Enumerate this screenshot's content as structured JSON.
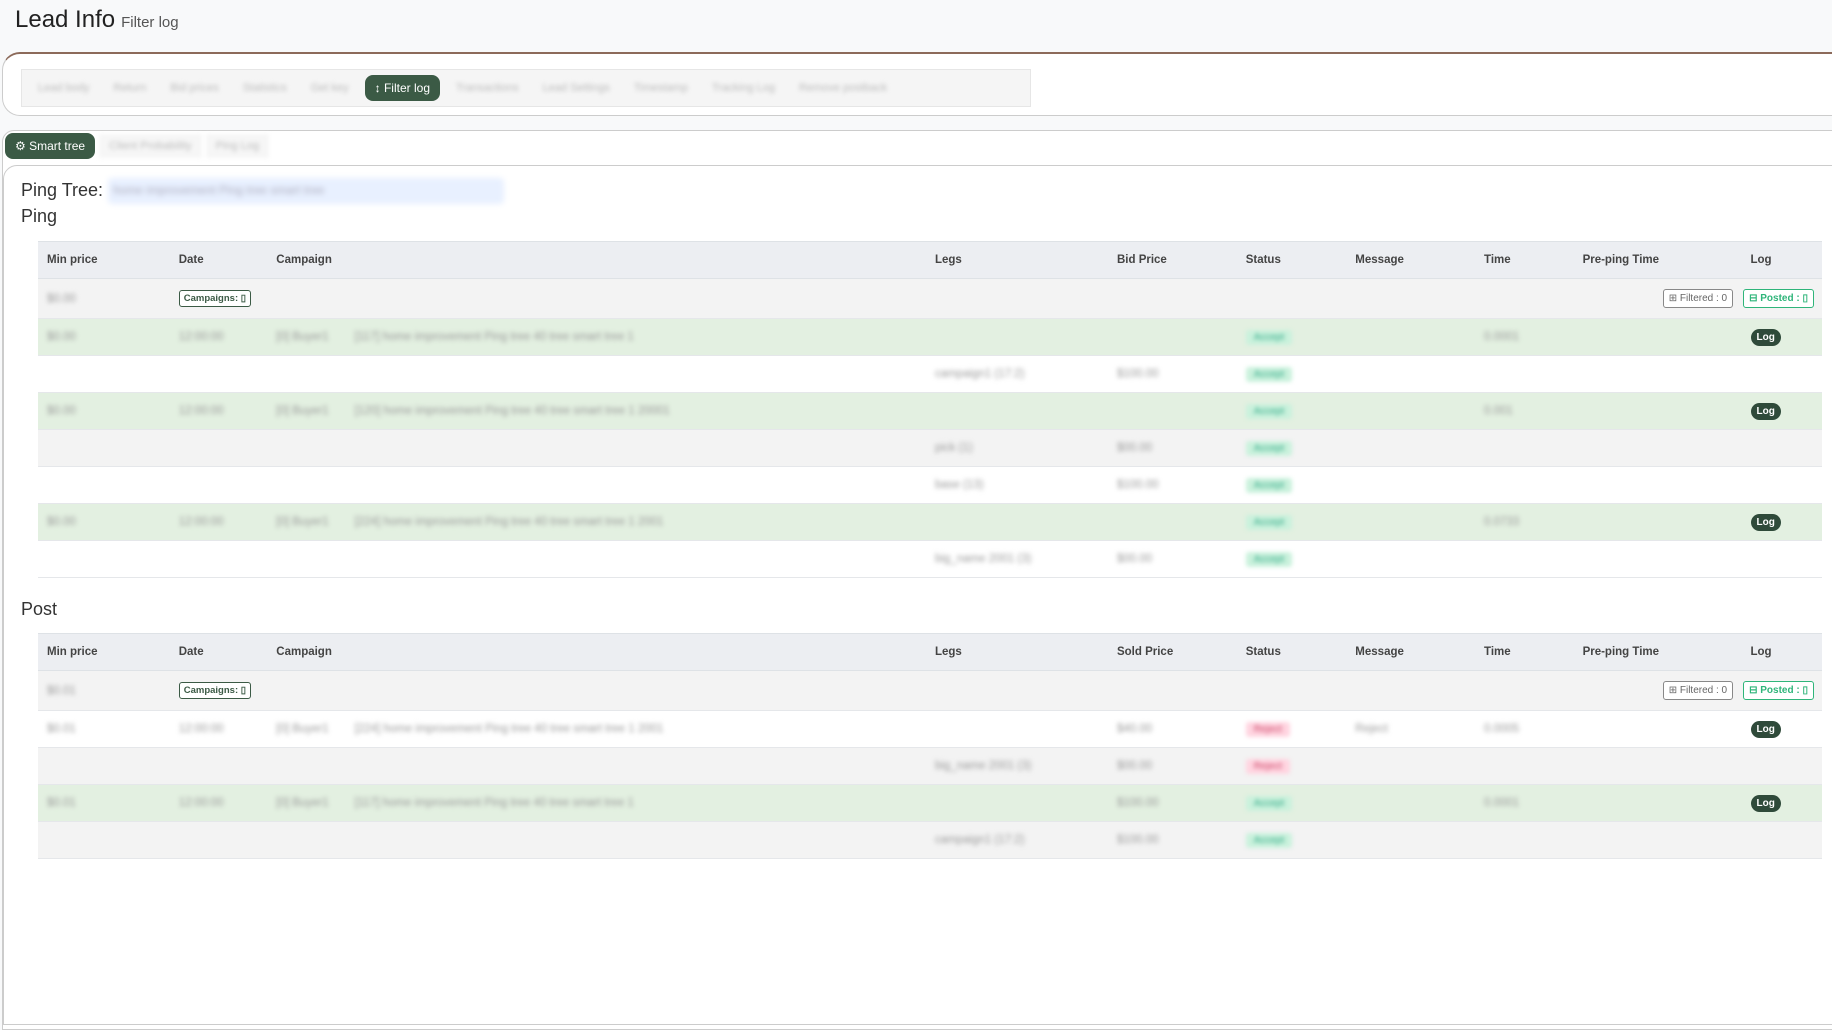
{
  "header": {
    "title": "Lead Info",
    "subtitle": "Filter log"
  },
  "tabs": [
    "Lead body",
    "Return",
    "Bid prices",
    "Statistics",
    "Get key",
    "Filter log",
    "Transactions",
    "Lead Settings",
    "Timestamp",
    "Tracking Log",
    "Remove postback"
  ],
  "subtabs": [
    "Smart tree",
    "Client Probability",
    "Ping Log"
  ],
  "ping_tree_label": "Ping Tree:",
  "ping_tree_value": "home improvement Ping tree smart tree",
  "ping": {
    "title": "Ping",
    "headers": [
      "Min price",
      "Date",
      "Campaign",
      "Legs",
      "Bid Price",
      "Status",
      "Message",
      "Time",
      "Pre-ping Time",
      "Log"
    ],
    "summary": {
      "min": "$0.00",
      "campaigns": "Campaigns:",
      "filtered": "Filtered : 0",
      "posted": "Posted :"
    },
    "rows": [
      {
        "type": "g",
        "min": "$0.00",
        "date": "12:00:00",
        "id": "[0] Buyer1",
        "camp": "[117] home improvement Ping tree 40 tree smart tree 1",
        "legs": "",
        "price": "",
        "status": "Accept",
        "time": "0.0001",
        "log": "Log"
      },
      {
        "type": "w",
        "legs": "campaign1 (17:2)",
        "price": "$100.00",
        "status": "Accept"
      },
      {
        "type": "g",
        "min": "$0.00",
        "date": "12:00:00",
        "id": "[0] Buyer1",
        "camp": "[120] home improvement Ping tree 40 tree smart tree 1 20001",
        "legs": "",
        "price": "",
        "status": "Accept",
        "time": "0.001",
        "log": "Log"
      },
      {
        "type": "gr",
        "legs": "pick (1)",
        "price": "$00.00",
        "status": "Accept"
      },
      {
        "type": "w",
        "legs": "base (13)",
        "price": "$100.00",
        "status": "Accept"
      },
      {
        "type": "g",
        "min": "$0.00",
        "date": "12:00:00",
        "id": "[0] Buyer1",
        "camp": "[224] home improvement Ping tree 40 tree smart tree 1 2001",
        "legs": "",
        "price": "",
        "status": "Accept",
        "time": "0.0733",
        "log": "Log"
      },
      {
        "type": "w",
        "legs": "big_name 2001 (3)",
        "price": "$00.00",
        "status": "Accept"
      }
    ]
  },
  "post": {
    "title": "Post",
    "headers": [
      "Min price",
      "Date",
      "Campaign",
      "Legs",
      "Sold Price",
      "Status",
      "Message",
      "Time",
      "Pre-ping Time",
      "Log"
    ],
    "summary": {
      "min": "$0.01",
      "campaigns": "Campaigns:",
      "filtered": "Filtered : 0",
      "posted": "Posted :"
    },
    "rows": [
      {
        "type": "w",
        "min": "$0.01",
        "date": "12:00:00",
        "id": "[0] Buyer1",
        "camp": "[224] home improvement Ping tree 40 tree smart tree 1 2001",
        "legs": "",
        "price": "$40.00",
        "status": "Reject",
        "msg": "Reject",
        "time": "0.0005",
        "log": "Log",
        "rej": true
      },
      {
        "type": "gr",
        "legs": "big_name 2001 (3)",
        "price": "$00.00",
        "status": "Reject",
        "rej": true
      },
      {
        "type": "g",
        "min": "$0.01",
        "date": "12:00:00",
        "id": "[0] Buyer1",
        "camp": "[117] home improvement Ping tree 40 tree smart tree 1",
        "legs": "",
        "price": "$100.00",
        "status": "Accept",
        "time": "0.0001",
        "log": "Log"
      },
      {
        "type": "gr",
        "legs": "campaign1 (17:2)",
        "price": "$100.00",
        "status": "Accept"
      }
    ]
  }
}
